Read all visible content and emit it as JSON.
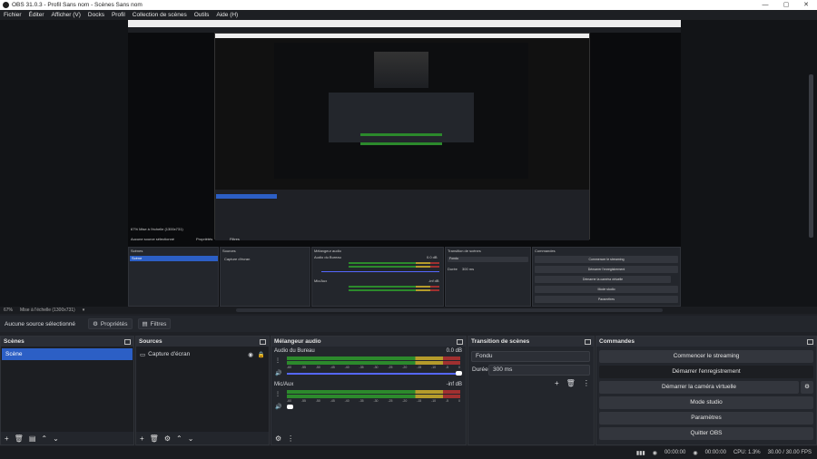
{
  "window": {
    "title": "OBS 31.0.3 - Profil Sans nom - Scènes Sans nom"
  },
  "menu": [
    "Fichier",
    "Éditer",
    "Afficher (V)",
    "Docks",
    "Profil",
    "Collection de scènes",
    "Outils",
    "Aide (H)"
  ],
  "status_line": {
    "zoom": "67%",
    "scale": "Mise à l'échelle (1300x731)"
  },
  "properties_bar": {
    "no_source": "Aucune source sélectionné",
    "properties": "Propriétés",
    "filters": "Filtres"
  },
  "scenes": {
    "title": "Scènes",
    "items": [
      "Scène"
    ]
  },
  "sources": {
    "title": "Sources",
    "items": [
      "Capture d'écran"
    ]
  },
  "mixer": {
    "title": "Mélangeur audio",
    "channels": [
      {
        "name": "Audio du Bureau",
        "level": "0.0 dB"
      },
      {
        "name": "Mic/Aux",
        "level": "-inf dB"
      }
    ],
    "ticks": [
      "-60",
      "-55",
      "-50",
      "-45",
      "-40",
      "-35",
      "-30",
      "-25",
      "-20",
      "-15",
      "-10",
      "-5",
      "0"
    ]
  },
  "transitions": {
    "title": "Transition de scènes",
    "type": "Fondu",
    "duration_label": "Durée",
    "duration_value": "300 ms"
  },
  "commands": {
    "title": "Commandes",
    "buttons": [
      "Commencer le streaming",
      "Démarrer l'enregistrement",
      "Démarrer la caméra virtuelle",
      "Mode studio",
      "Paramètres",
      "Quitter OBS"
    ]
  },
  "statusbar": {
    "rec_time": "00:00:00",
    "stream_time": "00:00:00",
    "cpu": "CPU: 1.3%",
    "fps": "30.00 / 30.00 FPS"
  },
  "nested": {
    "scene": "Scène",
    "source": "Capture d'écran",
    "mixer": "Mélangeur audio",
    "desktop_audio": "Audio du Bureau",
    "mic": "Mic/Aux",
    "transition": "Transition de scènes",
    "fade": "Fondu",
    "duration": "Durée",
    "duration_value": "300 ms",
    "commands": "Commandes",
    "btns": [
      "Commencer le streaming",
      "Démarrer l'enregistrement",
      "Démarrer la caméra virtuelle",
      "Mode studio",
      "Paramètres"
    ],
    "no_source": "Aucune source sélectionné",
    "properties": "Propriétés",
    "filters": "Filtres",
    "scenes": "Scènes",
    "sources": "Sources",
    "level0": "0.0 dB",
    "level1": "-inf dB"
  },
  "colors": {
    "accent": "#2c5fc5",
    "meter_green": "#2c8a2c",
    "meter_yellow": "#b59b2b",
    "meter_red": "#a03030"
  }
}
